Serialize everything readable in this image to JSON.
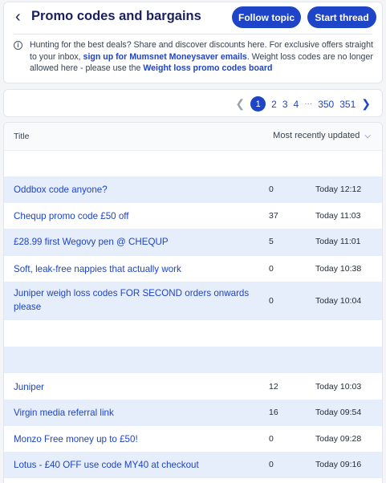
{
  "header": {
    "title": "Promo codes and bargains",
    "follow_label": "Follow topic",
    "start_label": "Start thread",
    "info_prefix": "Hunting for the best deals? Share and discover discounts here. For exclusive offers straight to your inbox, ",
    "info_link1": "sign up for Mumsnet Moneysaver emails",
    "info_middle": ". Weight loss codes are no longer allowed here - please use the ",
    "info_link2": "Weight loss promo codes board"
  },
  "pagination": {
    "pages": [
      "1",
      "2",
      "3",
      "4"
    ],
    "ellipsis": "···",
    "last_pages": [
      "350",
      "351"
    ],
    "current": "1"
  },
  "table": {
    "col_title": "Title",
    "sort_label": "Most recently updated",
    "rows": [
      {
        "title": "Oddbox code anyone?",
        "replies": "0",
        "updated": "Today 12:12"
      },
      {
        "title": "Chequp promo code £50 off",
        "replies": "37",
        "updated": "Today 11:03"
      },
      {
        "title": "£28.99 first Wegovy pen @ CHEQUP",
        "replies": "5",
        "updated": "Today 11:01"
      },
      {
        "title": "Soft, leak-free nappies that actually work",
        "replies": "0",
        "updated": "Today 10:38"
      },
      {
        "title": "Juniper weigh loss codes FOR SECOND orders onwards please",
        "replies": "0",
        "updated": "Today 10:04"
      },
      {
        "title": "Juniper",
        "replies": "12",
        "updated": "Today 10:03"
      },
      {
        "title": "Virgin media referral link",
        "replies": "16",
        "updated": "Today 09:54"
      },
      {
        "title": "Monzo Free money up to £50!",
        "replies": "0",
        "updated": "Today 09:28"
      },
      {
        "title": "Lotus - £40 OFF use code MY40 at checkout",
        "replies": "0",
        "updated": "Today 09:16"
      }
    ]
  },
  "icons": {
    "back": "chevron-left-icon",
    "info": "info-icon",
    "sort": "chevron-down-icon",
    "prev": "chevron-left-icon",
    "next": "chevron-right-icon"
  },
  "colors": {
    "accent": "#1e44c8",
    "title": "#1b1f5e",
    "row_alt": "#e6eefc",
    "background": "#f4f5f7"
  }
}
